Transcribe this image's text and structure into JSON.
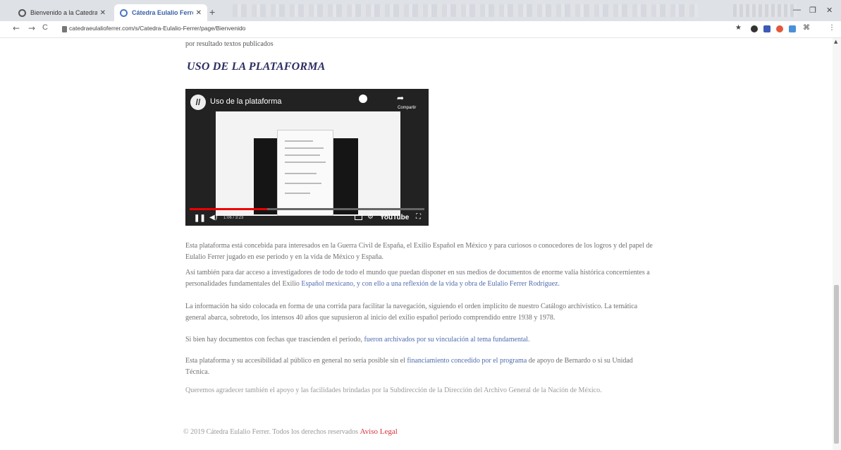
{
  "browser": {
    "tabs": [
      {
        "title": "Bienvenido a la Catedra E..",
        "active": false
      },
      {
        "title": "Cátedra Eulalio Ferrer",
        "active": true
      }
    ],
    "new_tab": "+",
    "window_controls": {
      "minimize": "—",
      "restore": "❐",
      "close": "✕"
    },
    "nav": {
      "back": "←",
      "forward": "→",
      "reload": "C"
    },
    "url": "catedraeulalioferrer.com/s/Catedra-Eulalio-Ferrer/page/Bienvenido",
    "extensions": [
      "star",
      "extension-1",
      "extension-2",
      "extension-3",
      "extension-4",
      "extension-5"
    ],
    "menu": "⋮"
  },
  "page": {
    "lead_text": "por resultado textos publicados",
    "section_title": "USO DE LA PLATAFORMA",
    "video": {
      "title": "Uso de la plataforma",
      "share_label": "Compartir",
      "time": "1:06 / 3:23",
      "progress": 0.33,
      "youtube_label": "YouTube"
    },
    "paragraphs": {
      "p1": "Esta plataforma está concebida para interesados en la Guerra Civil de España, el Exilio Español en México y para curiosos o conocedores de los logros y del papel de Eulalio Ferrer jugado en ese periodo y en la vida de México y España.",
      "p2a": "Así también para dar acceso a investigadores de todo de todo el mundo que puedan disponer en sus medios de documentos de enorme valía histórica concernientes a personalidades fundamentales del Exilio ",
      "p2b": "Español mexicano, y con ello a una reflexión de la vida y obra de Eulalio Ferrer Rodríguez.",
      "p3": "La información ha sido colocada en forma de una corrida para facilitar la navegación, siguiendo el orden implícito de nuestro Catálogo archivístico. La temática general abarca, sobretodo, los intensos 40 años que supusieron al inicio del exilio español periodo comprendido entre 1938 y 1978.",
      "p4a": "Si bien hay documentos con fechas que trascienden el periodo, ",
      "p4b": "fueron archivados por su vinculación al tema fundamental.",
      "p5a": "Esta plataforma y su accesibilidad al público en general no sería posible sin el ",
      "p5b": "financiamiento concedido por el programa",
      "p5c": " de apoyo de Bernardo o si su Unidad Técnica.",
      "p6": "Queremos agradecer también el apoyo y las facilidades brindadas por la Subdirección de la Dirección del Archivo General de la Nación de México."
    },
    "footer": {
      "copyright": "© 2019 Cátedra Eulalio Ferrer. Todos los derechos reservados ",
      "legal_link": "Aviso Legal"
    }
  }
}
